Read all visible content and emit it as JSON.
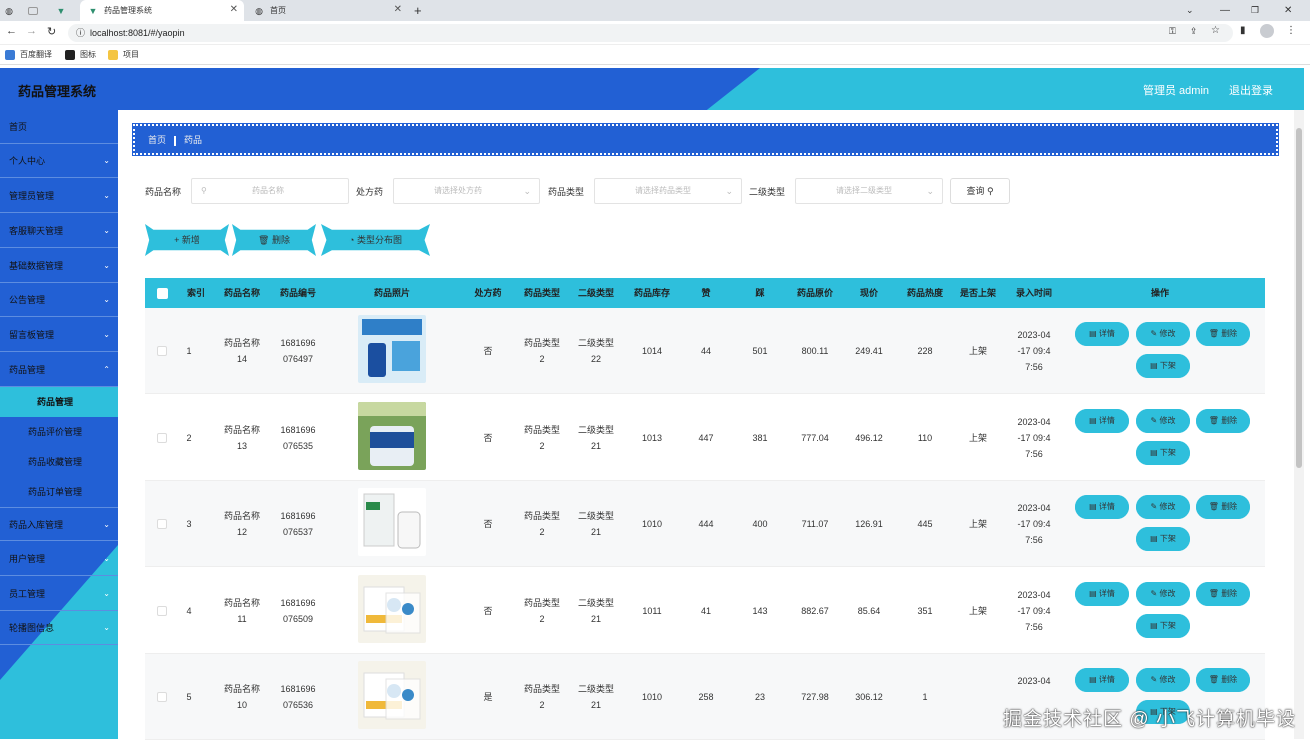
{
  "browser": {
    "tabs": [
      {
        "label": "",
        "icon": "globe-icon"
      },
      {
        "label": "",
        "icon": "blank-tab-icon"
      },
      {
        "label": "",
        "icon": "vue-icon"
      },
      {
        "label": "药品管理系统",
        "icon": "vue-icon"
      },
      {
        "label": "首页",
        "icon": "globe-icon"
      }
    ],
    "url": "localhost:8081/#/yaopin",
    "bookmarks": [
      "百度翻译",
      "图标",
      "项目"
    ]
  },
  "header": {
    "title": "药品管理系统",
    "user": "管理员 admin",
    "logout": "退出登录"
  },
  "sidebar": {
    "items": [
      {
        "label": "首页",
        "chevron": false
      },
      {
        "label": "个人中心",
        "chevron": true
      },
      {
        "label": "管理员管理",
        "chevron": true
      },
      {
        "label": "客服聊天管理",
        "chevron": true
      },
      {
        "label": "基础数据管理",
        "chevron": true
      },
      {
        "label": "公告管理",
        "chevron": true
      },
      {
        "label": "留言板管理",
        "chevron": true
      },
      {
        "label": "药品管理",
        "chevron": true
      }
    ],
    "sub": [
      "药品管理",
      "药品评价管理",
      "药品收藏管理",
      "药品订单管理"
    ],
    "items2": [
      {
        "label": "药品入库管理",
        "chevron": true
      },
      {
        "label": "用户管理",
        "chevron": true
      },
      {
        "label": "员工管理",
        "chevron": true
      },
      {
        "label": "轮播图信息",
        "chevron": true
      }
    ]
  },
  "breadcrumb": {
    "home": "首页",
    "current": "药品"
  },
  "filters": {
    "name_label": "药品名称",
    "name_placeholder": "药品名称",
    "rx_label": "处方药",
    "rx_placeholder": "请选择处方药",
    "type_label": "药品类型",
    "type_placeholder": "请选择药品类型",
    "type2_label": "二级类型",
    "type2_placeholder": "请选择二级类型",
    "query": "查询"
  },
  "actions": {
    "add": "+ 新增",
    "delete": "删除",
    "chart": "类型分布图"
  },
  "table": {
    "headers": [
      "索引",
      "药品名称",
      "药品编号",
      "药品照片",
      "处方药",
      "药品类型",
      "二级类型",
      "药品库存",
      "赞",
      "踩",
      "药品原价",
      "现价",
      "药品热度",
      "是否上架",
      "录入时间",
      "操作"
    ],
    "op_labels": {
      "detail": "详情",
      "edit": "修改",
      "delete": "删除",
      "off": "下架"
    },
    "rows": [
      {
        "index": "1",
        "name1": "药品名称",
        "name2": "14",
        "code1": "1681696",
        "code2": "076497",
        "rx": "否",
        "type1": "药品类型",
        "type2": "2",
        "sub1": "二级类型",
        "sub2": "22",
        "stock": "1014",
        "up": "44",
        "down": "501",
        "orig": "800.11",
        "price": "249.41",
        "hot": "228",
        "status": "上架",
        "t1": "2023-04",
        "t2": "-17 09:4",
        "t3": "7:56",
        "pic": "blue"
      },
      {
        "index": "2",
        "name1": "药品名称",
        "name2": "13",
        "code1": "1681696",
        "code2": "076535",
        "rx": "否",
        "type1": "药品类型",
        "type2": "2",
        "sub1": "二级类型",
        "sub2": "21",
        "stock": "1013",
        "up": "447",
        "down": "381",
        "orig": "777.04",
        "price": "496.12",
        "hot": "110",
        "status": "上架",
        "t1": "2023-04",
        "t2": "-17 09:4",
        "t3": "7:56",
        "pic": "shelf"
      },
      {
        "index": "3",
        "name1": "药品名称",
        "name2": "12",
        "code1": "1681696",
        "code2": "076537",
        "rx": "否",
        "type1": "药品类型",
        "type2": "2",
        "sub1": "二级类型",
        "sub2": "21",
        "stock": "1010",
        "up": "444",
        "down": "400",
        "orig": "711.07",
        "price": "126.91",
        "hot": "445",
        "status": "上架",
        "t1": "2023-04",
        "t2": "-17 09:4",
        "t3": "7:56",
        "pic": "white"
      },
      {
        "index": "4",
        "name1": "药品名称",
        "name2": "11",
        "code1": "1681696",
        "code2": "076509",
        "rx": "否",
        "type1": "药品类型",
        "type2": "2",
        "sub1": "二级类型",
        "sub2": "21",
        "stock": "1011",
        "up": "41",
        "down": "143",
        "orig": "882.67",
        "price": "85.64",
        "hot": "351",
        "status": "上架",
        "t1": "2023-04",
        "t2": "-17 09:4",
        "t3": "7:56",
        "pic": "box"
      },
      {
        "index": "5",
        "name1": "药品名称",
        "name2": "10",
        "code1": "1681696",
        "code2": "076536",
        "rx": "是",
        "type1": "药品类型",
        "type2": "2",
        "sub1": "二级类型",
        "sub2": "21",
        "stock": "1010",
        "up": "258",
        "down": "23",
        "orig": "727.98",
        "price": "306.12",
        "hot": "1",
        "status": "",
        "t1": "2023-04",
        "t2": "",
        "t3": "",
        "pic": "box"
      }
    ]
  },
  "watermark": "掘金技术社区 @ 小飞计算机毕设",
  "colors": {
    "blue": "#2260d4",
    "cyan": "#2ebfdc"
  }
}
